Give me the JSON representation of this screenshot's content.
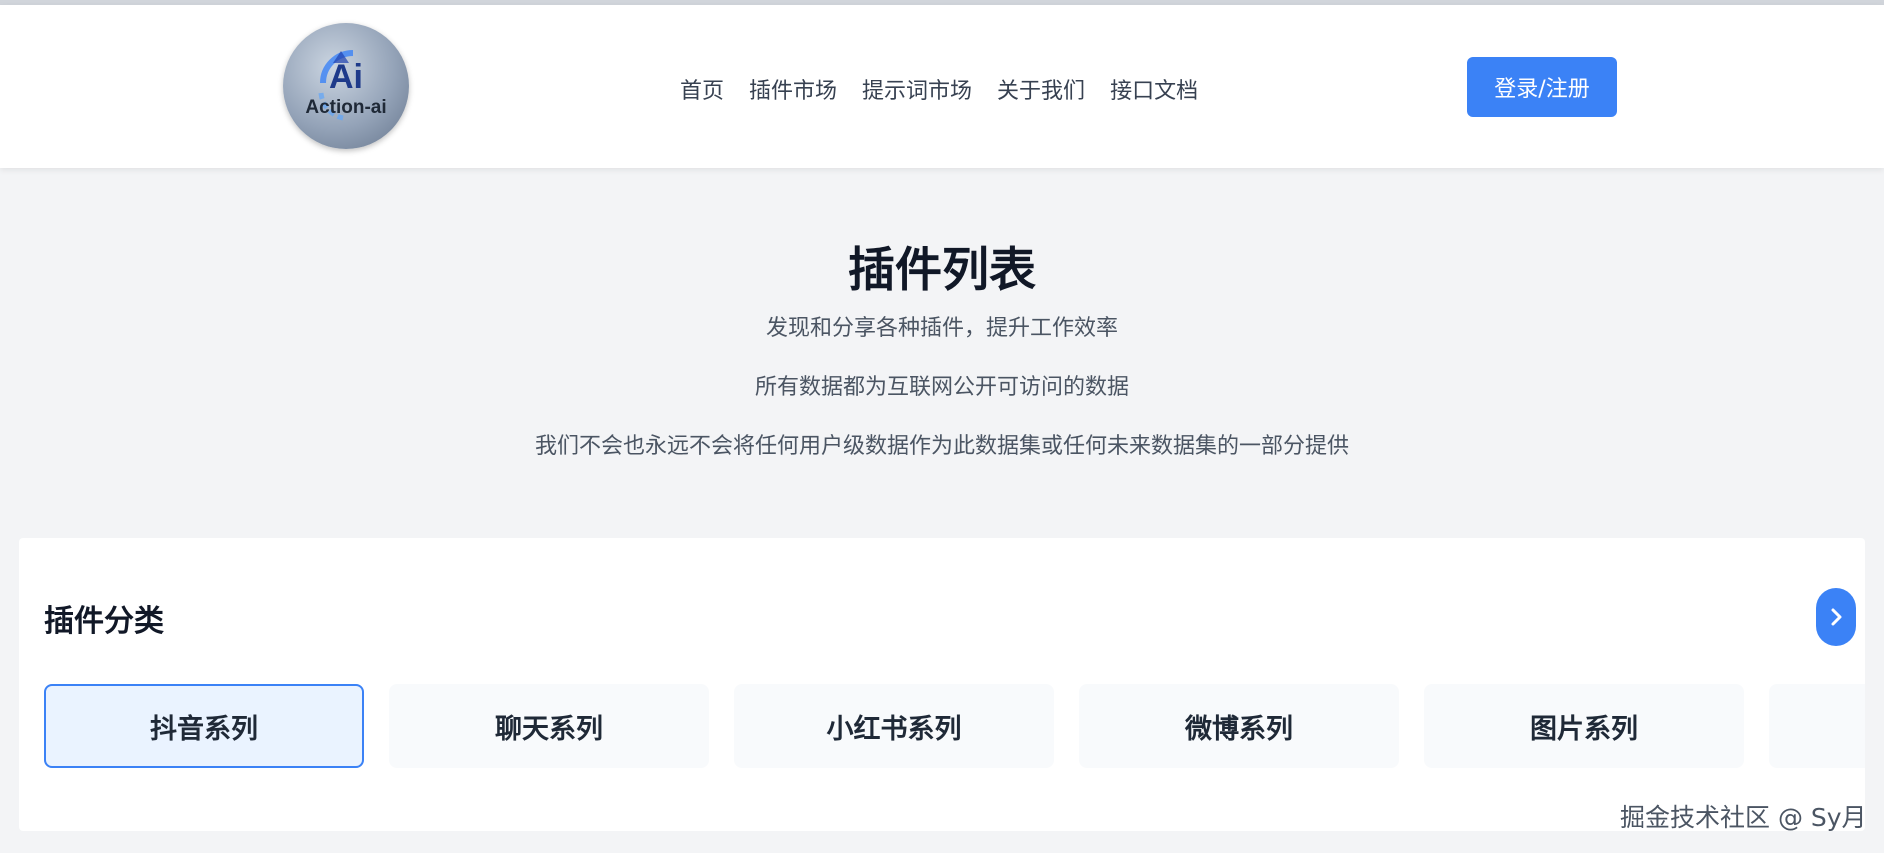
{
  "header": {
    "logo_text_top": "Ai",
    "logo_text_bottom": "Action-ai",
    "nav": [
      {
        "label": "首页"
      },
      {
        "label": "插件市场"
      },
      {
        "label": "提示词市场"
      },
      {
        "label": "关于我们"
      },
      {
        "label": "接口文档"
      }
    ],
    "login_label": "登录/注册"
  },
  "hero": {
    "title": "插件列表",
    "subtitle": "发现和分享各种插件，提升工作效率",
    "note1": "所有数据都为互联网公开可访问的数据",
    "note2": "我们不会也永远不会将任何用户级数据作为此数据集或任何未来数据集的一部分提供"
  },
  "categories": {
    "title": "插件分类",
    "next_icon": "chevron-right-icon",
    "items": [
      {
        "label": "抖音系列",
        "active": true
      },
      {
        "label": "聊天系列",
        "active": false
      },
      {
        "label": "小红书系列",
        "active": false
      },
      {
        "label": "微博系列",
        "active": false
      },
      {
        "label": "图片系列",
        "active": false
      },
      {
        "label": "",
        "active": false
      }
    ]
  },
  "watermark": "掘金技术社区 @ Sy月",
  "colors": {
    "accent": "#3b82f6",
    "background": "#f3f4f6",
    "active_card_bg": "#eaf3ff"
  }
}
